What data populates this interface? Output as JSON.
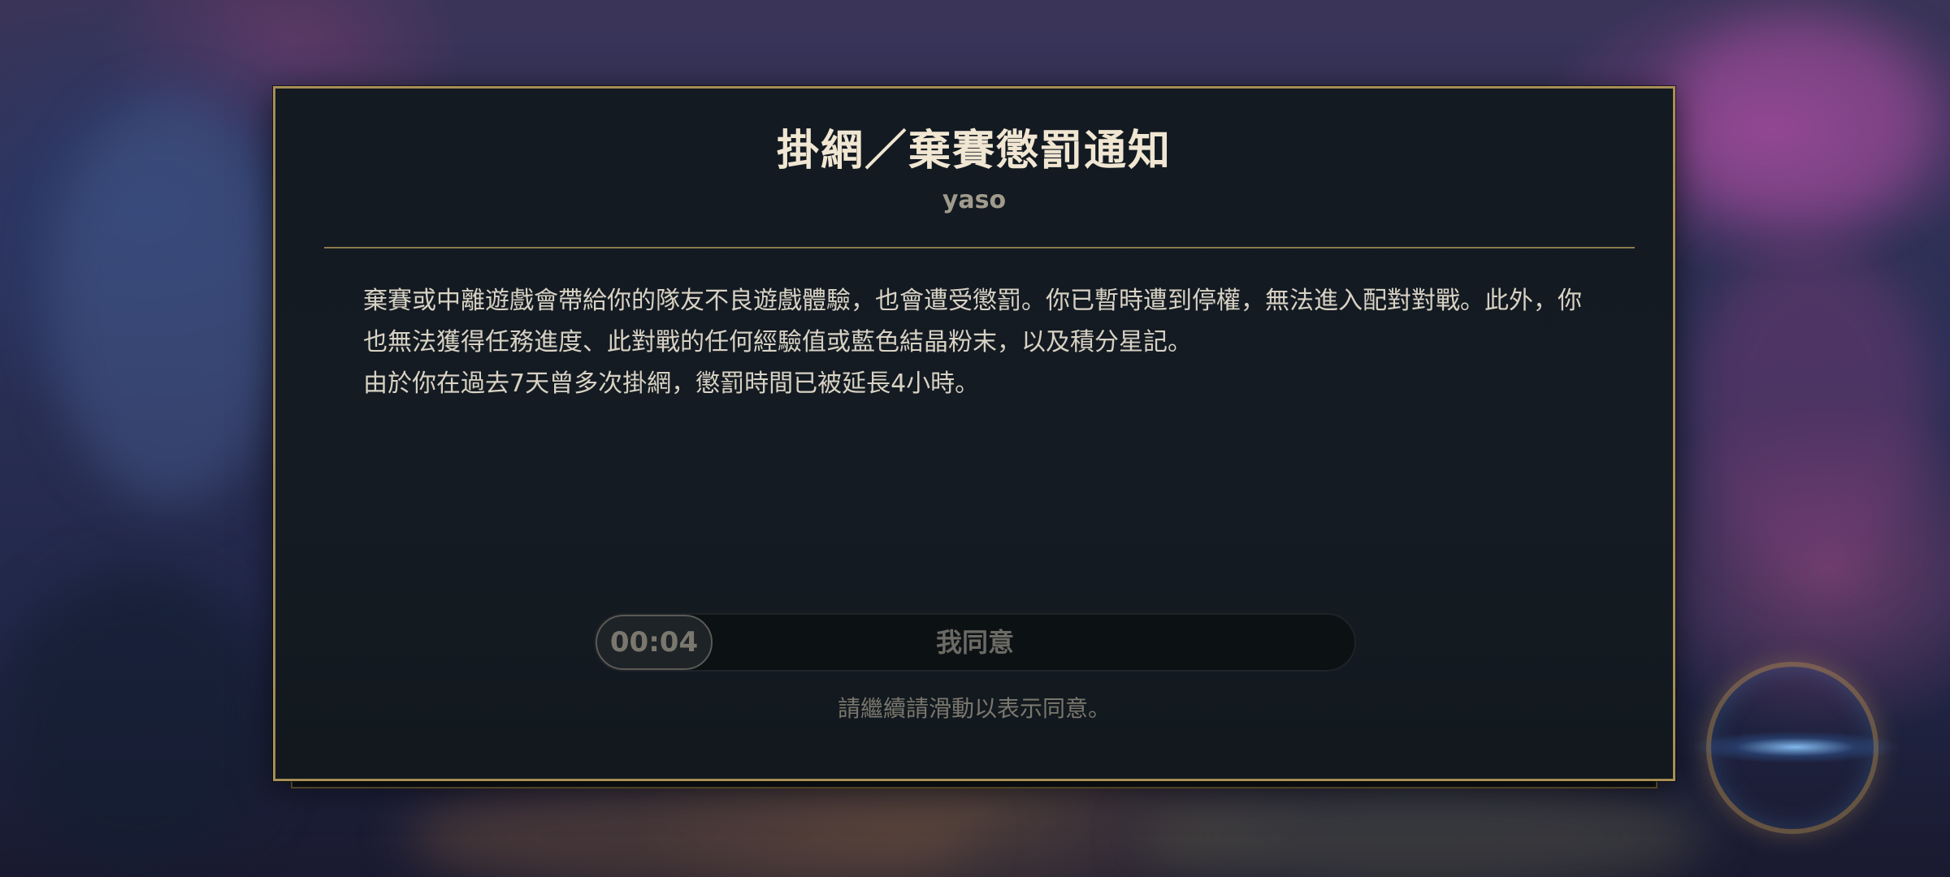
{
  "dialog": {
    "title": "掛網／棄賽懲罰通知",
    "summoner_name": "yaso",
    "body_paragraphs": [
      "棄賽或中離遊戲會帶給你的隊友不良遊戲體驗，也會遭受懲罰。你已暫時遭到停權，無法進入配對對戰。此外，你也無法獲得任務進度、此對戰的任何經驗值或藍色結晶粉末，以及積分星記。",
      "由於你在過去7天曾多次掛網，懲罰時間已被延長4小時。"
    ],
    "slider": {
      "timer": "00:04",
      "label": "我同意"
    },
    "hint": "請繼續請滑動以表示同意。"
  },
  "colors": {
    "border_gold": "#a68e55",
    "title_text": "#f0e6d2",
    "dialog_bg": "#131a21"
  }
}
